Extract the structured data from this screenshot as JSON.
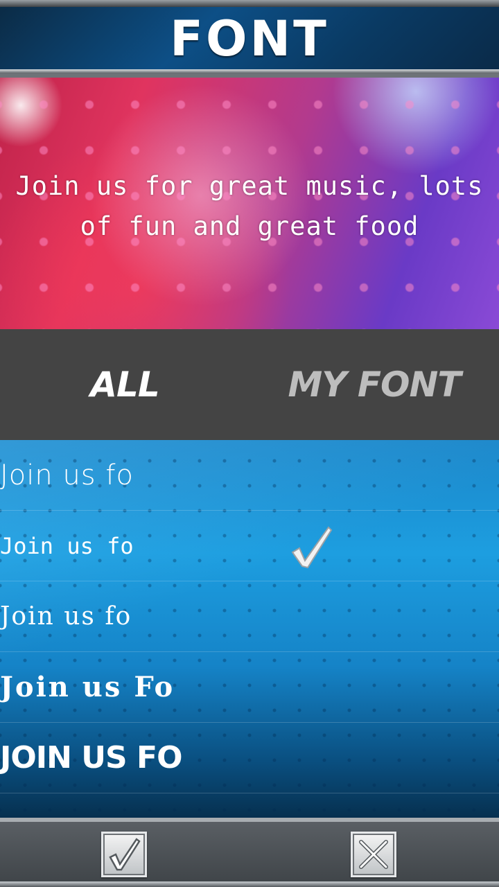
{
  "header": {
    "title": "FONT"
  },
  "preview": {
    "text": "Join us for great music, lots of fun and great food"
  },
  "tabs": [
    {
      "label": "ALL",
      "active": true
    },
    {
      "label": "MY FONT",
      "active": false
    }
  ],
  "font_list": [
    {
      "sample": "Join us fo",
      "selected": false
    },
    {
      "sample": "Join us fo",
      "selected": true
    },
    {
      "sample": "Join us fo",
      "selected": false
    },
    {
      "sample": "Join us Fo",
      "selected": false
    },
    {
      "sample": "JOIN US FO",
      "selected": false
    }
  ],
  "icons": {
    "selected_marker": "checkmark-icon",
    "confirm": "checkmark-icon",
    "cancel": "close-icon"
  },
  "colors": {
    "tab_bar": "#444444",
    "tab_active": "#ffffff",
    "tab_inactive": "#bdbdbd",
    "list_blue": "#1d9ee0"
  }
}
